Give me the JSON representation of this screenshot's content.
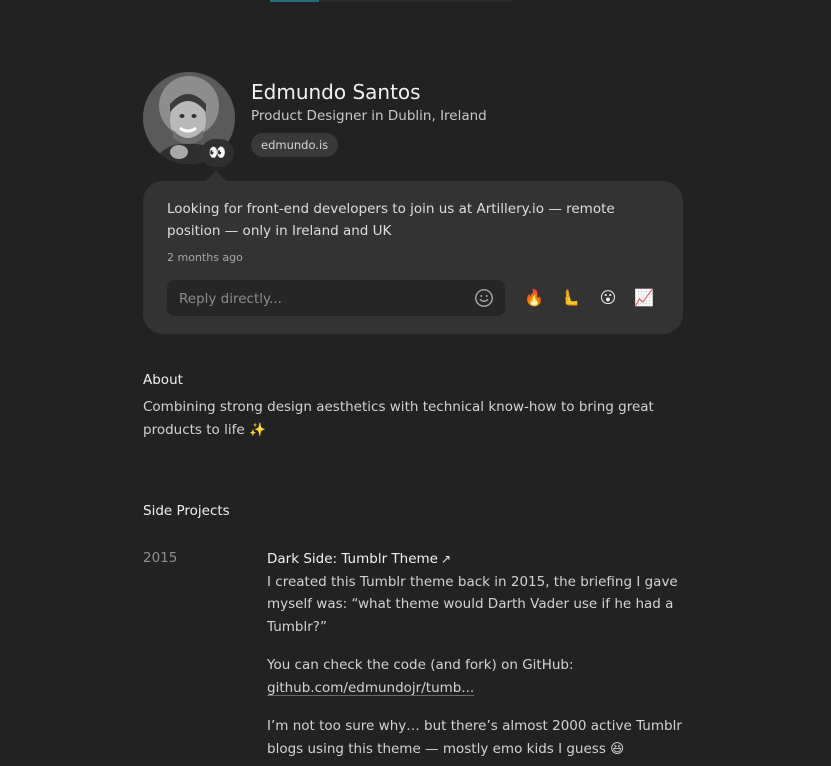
{
  "profile": {
    "name": "Edmundo Santos",
    "role": "Product Designer in Dublin, Ireland",
    "website": "edmundo.is",
    "status_emoji": "👀"
  },
  "status": {
    "text": "Looking for front-end developers to join us at Artillery.io — remote position — only in Ireland and UK",
    "time": "2 months ago",
    "reply_placeholder": "Reply directly...",
    "reactions": [
      "🔥",
      "🫷",
      "😮",
      "📈"
    ]
  },
  "about": {
    "title": "About",
    "text": "Combining strong design aesthetics with technical know-how to bring great products to life ✨"
  },
  "side_projects": {
    "title": "Side Projects",
    "items": [
      {
        "year": "2015",
        "title": "Dark Side: Tumblr Theme",
        "arrow": "↗",
        "para1": "I created this Tumblr theme back in 2015, the briefing I gave myself was: “what theme would Darth Vader use if he had a Tumblr?”",
        "para2_prefix": "You can check the code (and fork) on GitHub:",
        "para2_link": "github.com/edmundojr/tumb...",
        "para3": "I’m not too sure why… but there’s almost 2000 active Tumblr blogs using this theme — mostly emo kids I guess 😆"
      }
    ]
  },
  "icons": {
    "emoji_picker": "smiley-outline-icon",
    "external_link": "arrow-up-right-icon"
  },
  "colors": {
    "background": "#222222",
    "card": "#333333",
    "accent": "#1e6f80"
  }
}
